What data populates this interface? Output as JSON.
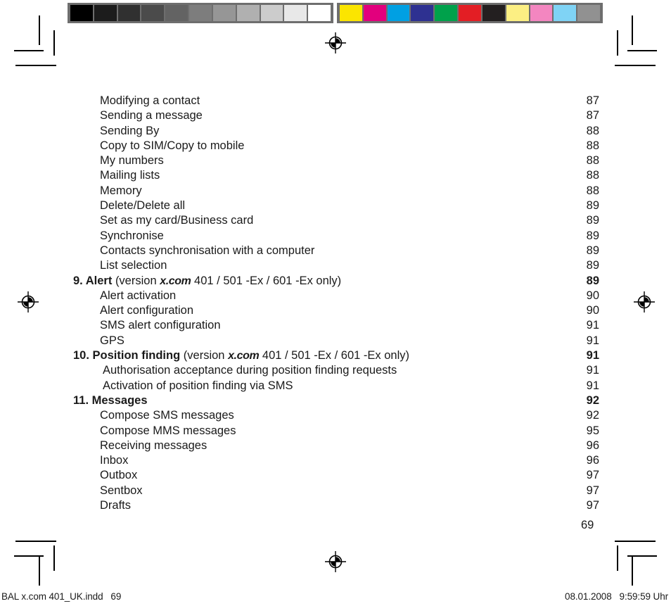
{
  "document": {
    "folio": "69",
    "footer_left": "BAL x.com 401_UK.indd   69",
    "footer_right": "08.01.2008   9:59:59 Uhr"
  },
  "print_strips": {
    "grayscale_label": "grayscale-control-strip",
    "grayscale_swatches": [
      "#000000",
      "#1c1c1c",
      "#303030",
      "#4b4b4b",
      "#636363",
      "#7d7d7d",
      "#969696",
      "#b0b0b0",
      "#cccccc",
      "#e8e8e8",
      "#ffffff"
    ],
    "color_label": "color-control-strip",
    "color_swatches": [
      "#fbe500",
      "#e2007d",
      "#00a0e3",
      "#2e3191",
      "#00a14b",
      "#e31e24",
      "#231f20",
      "#fcef83",
      "#f386c0",
      "#7fd3f5",
      "#919191"
    ],
    "strip_background": "#6e6e6e"
  },
  "marks": {
    "registration_mark": "registration-target-mark",
    "crop_mark": "crop-mark"
  },
  "toc": {
    "entries": [
      {
        "level": "sub",
        "text": "Modifying a contact",
        "page": "87"
      },
      {
        "level": "sub",
        "text": "Sending a message",
        "page": "87"
      },
      {
        "level": "sub",
        "text": "Sending By",
        "page": "88"
      },
      {
        "level": "sub",
        "text": "Copy to SIM/Copy to mobile",
        "page": "88"
      },
      {
        "level": "sub",
        "text": "My numbers",
        "page": "88"
      },
      {
        "level": "sub",
        "text": "Mailing lists",
        "page": "88"
      },
      {
        "level": "sub",
        "text": "Memory",
        "page": "88"
      },
      {
        "level": "sub",
        "text": "Delete/Delete all",
        "page": "89"
      },
      {
        "level": "sub",
        "text": "Set as my card/Business card",
        "page": "89"
      },
      {
        "level": "sub",
        "text": "Synchronise",
        "page": "89"
      },
      {
        "level": "sub",
        "text": "Contacts synchronisation with a computer",
        "page": "89"
      },
      {
        "level": "sub",
        "text": "List selection",
        "page": "89"
      },
      {
        "level": "chap",
        "num": "9.",
        "title": "Alert",
        "note_before": "(version ",
        "logo": "x.com",
        "note_after": " 401 / 501 -Ex / 601 -Ex only)",
        "page": "89"
      },
      {
        "level": "sub",
        "text": "Alert activation",
        "page": "90"
      },
      {
        "level": "sub",
        "text": "Alert configuration",
        "page": "90"
      },
      {
        "level": "sub",
        "text": "SMS alert configuration",
        "page": "91"
      },
      {
        "level": "sub",
        "text": "GPS",
        "page": "91"
      },
      {
        "level": "chap",
        "num": "10.",
        "title": "Position finding",
        "note_before": "(version ",
        "logo": "x.com",
        "note_after": " 401 / 501 -Ex / 601 -Ex only)",
        "page": "91"
      },
      {
        "level": "sub2",
        "text": "Authorisation acceptance during position finding requests",
        "page": "91"
      },
      {
        "level": "sub2",
        "text": "Activation of position finding via SMS",
        "page": "91"
      },
      {
        "level": "chap",
        "num": "11.",
        "title": "Messages",
        "page": "92"
      },
      {
        "level": "sub",
        "text": "Compose SMS messages",
        "page": "92"
      },
      {
        "level": "sub",
        "text": "Compose MMS messages",
        "page": "95"
      },
      {
        "level": "sub",
        "text": "Receiving messages",
        "page": "96"
      },
      {
        "level": "sub",
        "text": "Inbox",
        "page": "96"
      },
      {
        "level": "sub",
        "text": "Outbox",
        "page": "97"
      },
      {
        "level": "sub",
        "text": "Sentbox",
        "page": "97"
      },
      {
        "level": "sub",
        "text": "Drafts",
        "page": "97"
      }
    ]
  }
}
